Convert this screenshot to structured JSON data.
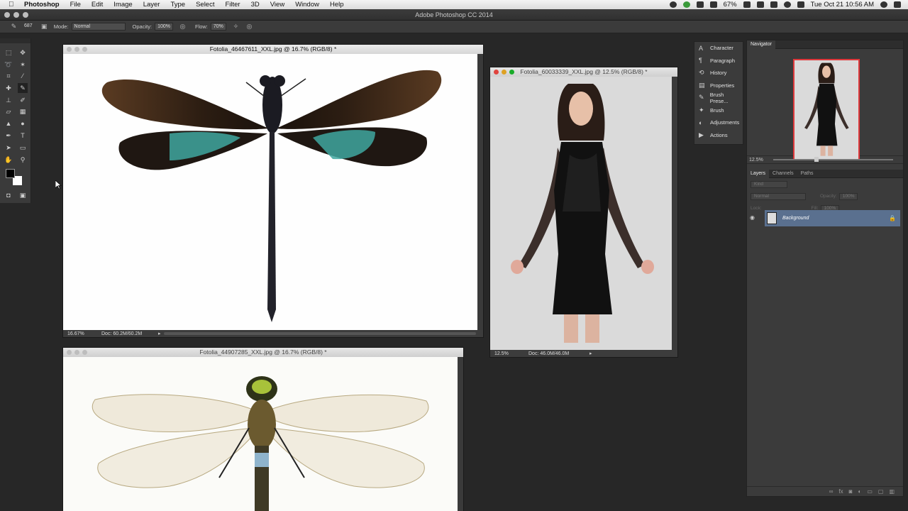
{
  "menubar": {
    "app": "Photoshop",
    "items": [
      "File",
      "Edit",
      "Image",
      "Layer",
      "Type",
      "Select",
      "Filter",
      "3D",
      "View",
      "Window",
      "Help"
    ],
    "battery": "67%",
    "clock": "Tue Oct 21  10:56 AM"
  },
  "app_title": "Adobe Photoshop CC 2014",
  "options_bar": {
    "brush_size": "687",
    "mode_label": "Mode:",
    "mode_value": "Normal",
    "opacity_label": "Opacity:",
    "opacity_value": "100%",
    "flow_label": "Flow:",
    "flow_value": "70%"
  },
  "documents": {
    "doc1": {
      "title": "Fotolia_46467611_XXL.jpg @ 16.7% (RGB/8) *",
      "zoom": "16.67%",
      "docsize": "Doc: 60.2M/60.2M"
    },
    "doc2": {
      "title": "Fotolia_60033339_XXL.jpg @ 12.5% (RGB/8) *",
      "zoom": "12.5%",
      "docsize": "Doc: 46.0M/46.0M"
    },
    "doc3": {
      "title": "Fotolia_44907285_XXL.jpg @ 16.7% (RGB/8) *"
    }
  },
  "panel_strip": [
    {
      "icon": "character-icon",
      "glyph": "A",
      "label": "Character"
    },
    {
      "icon": "paragraph-icon",
      "glyph": "¶",
      "label": "Paragraph"
    },
    {
      "icon": "history-icon",
      "glyph": "⟲",
      "label": "History"
    },
    {
      "icon": "properties-icon",
      "glyph": "▤",
      "label": "Properties"
    },
    {
      "icon": "brush-presets-icon",
      "glyph": "✎",
      "label": "Brush Prese..."
    },
    {
      "icon": "brush-icon",
      "glyph": "✦",
      "label": "Brush"
    },
    {
      "icon": "adjustments-icon",
      "glyph": "◐",
      "label": "Adjustments"
    },
    {
      "icon": "actions-icon",
      "glyph": "▶",
      "label": "Actions"
    }
  ],
  "navigator": {
    "tab": "Navigator",
    "zoom": "12.5%"
  },
  "layers_panel": {
    "tabs": [
      "Layers",
      "Channels",
      "Paths"
    ],
    "filter": "Kind",
    "blend": "Normal",
    "opacity_label": "Opacity:",
    "opacity_value": "100%",
    "lock_label": "Lock:",
    "fill_label": "Fill:",
    "fill_value": "100%",
    "layer_name": "Background"
  },
  "colors": {
    "accent": "#5a708f",
    "navigator_box": "#e0393c"
  }
}
